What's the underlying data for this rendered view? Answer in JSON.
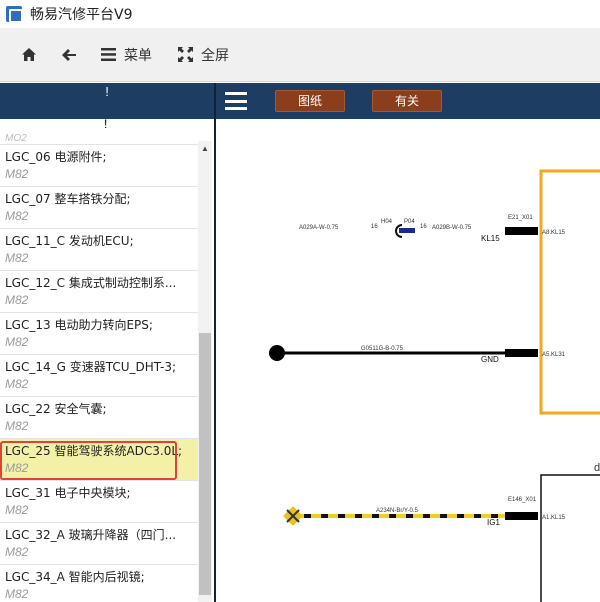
{
  "window": {
    "title": "畅易汽修平台V9"
  },
  "toolbar": {
    "home_label": "",
    "back_label": "",
    "menu_label": "菜单",
    "fullscreen_label": "全屏"
  },
  "left_header": {
    "mark1": "!",
    "mark2": "!"
  },
  "right_header": {
    "btn_drawing": "图纸",
    "btn_related": "有关"
  },
  "list": {
    "top_partial": "MO2",
    "items": [
      {
        "name": "LGC_06 电源附件;",
        "code": "M82"
      },
      {
        "name": "LGC_07 整车搭铁分配;",
        "code": "M82"
      },
      {
        "name": "LGC_11_C 发动机ECU;",
        "code": "M82"
      },
      {
        "name": "LGC_12_C 集成式制动控制系...",
        "code": "M82"
      },
      {
        "name": "LGC_13 电动助力转向EPS;",
        "code": "M82"
      },
      {
        "name": "LGC_14_G 变速器TCU_DHT-3;",
        "code": "M82"
      },
      {
        "name": "LGC_22 安全气囊;",
        "code": "M82"
      },
      {
        "name": "LGC_25 智能驾驶系统ADC3.0L;",
        "code": "M82"
      },
      {
        "name": "LGC_31 电子中央模块;",
        "code": "M82"
      },
      {
        "name": "LGC_32_A 玻璃升降器（四门...",
        "code": "M82"
      },
      {
        "name": "LGC_34_A 智能内后视镜;",
        "code": "M82"
      }
    ],
    "selected_index": 7
  },
  "diagram": {
    "wire1": {
      "left_label": "A029A-W-0.75",
      "pin_left": "16",
      "conn_top": "H04",
      "conn_top2": "P04",
      "pin_right": "16",
      "right_label": "A029B-W-0.75",
      "net": "KL15",
      "conn": "E21_X01",
      "pin": "A8.KL15"
    },
    "wire2": {
      "label": "G0511G-B-0.75",
      "net": "GND",
      "pin": "A5.KL31"
    },
    "wire3": {
      "label": "A234N-Br/Y-0.5",
      "net": "IG1",
      "conn": "E146_X01",
      "pin": "A1.KL15"
    },
    "box_label": "di",
    "colors": {
      "orange_box": "#f3a81f",
      "wire_yellow": "#f2cf1c",
      "wire_dark": "#111111"
    }
  }
}
